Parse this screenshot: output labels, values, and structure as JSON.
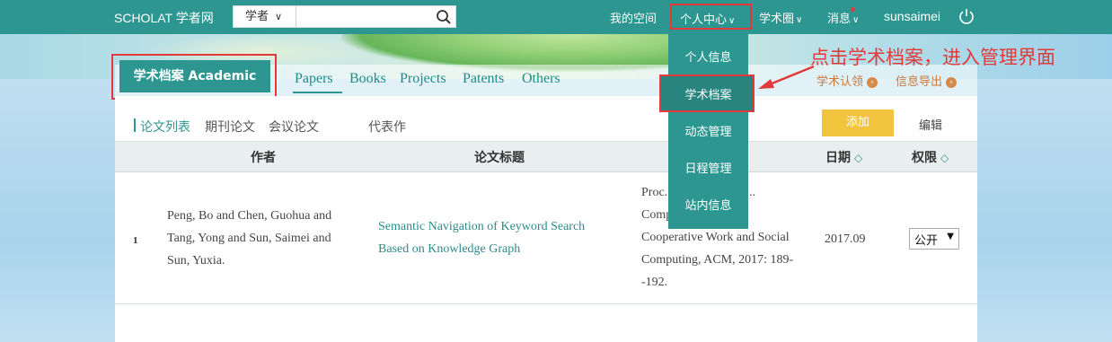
{
  "topbar": {
    "logo": "SCHOLAT 学者网",
    "search_type": "学者",
    "search_placeholder": "",
    "nav": {
      "my_space": "我的空间",
      "personal_center": "个人中心",
      "academic_circle": "学术圈",
      "messages": "消息",
      "username": "sunsaimei"
    }
  },
  "dropdown": {
    "items": [
      "个人信息",
      "学术档案",
      "动态管理",
      "日程管理",
      "站内信息"
    ]
  },
  "annotation": "点击学术档案，进入管理界面",
  "panel": {
    "title": "学术档案 Academic",
    "tabs": [
      "Papers",
      "Books",
      "Projects",
      "Patents",
      "Others"
    ],
    "head_links": {
      "certify": "学术认领",
      "export": "信息导出"
    },
    "subtabs": [
      "论文列表",
      "期刊论文",
      "会议论文",
      "代表作"
    ],
    "buttons": {
      "add": "添加",
      "edit": "编辑"
    },
    "table": {
      "columns": [
        "作者",
        "论文标题",
        "日期",
        "权限"
      ],
      "rows": [
        {
          "num": "1",
          "authors": "Peng, Bo and Chen, Guohua and Tang, Yong and Sun, Saimei and Sun, Yuxia.",
          "title": "Semantic Navigation of Keyword Search Based on Knowledge Graph",
          "venue": "Proc... 12th Chinese ... Computer Supported Cooperative Work and Social Computing, ACM, 2017: 189--192.",
          "date": "2017.09",
          "permission": "公开"
        }
      ]
    }
  },
  "colors": {
    "accent": "#2e9690",
    "highlight": "#e23a3a",
    "add_button": "#f2c33c"
  }
}
